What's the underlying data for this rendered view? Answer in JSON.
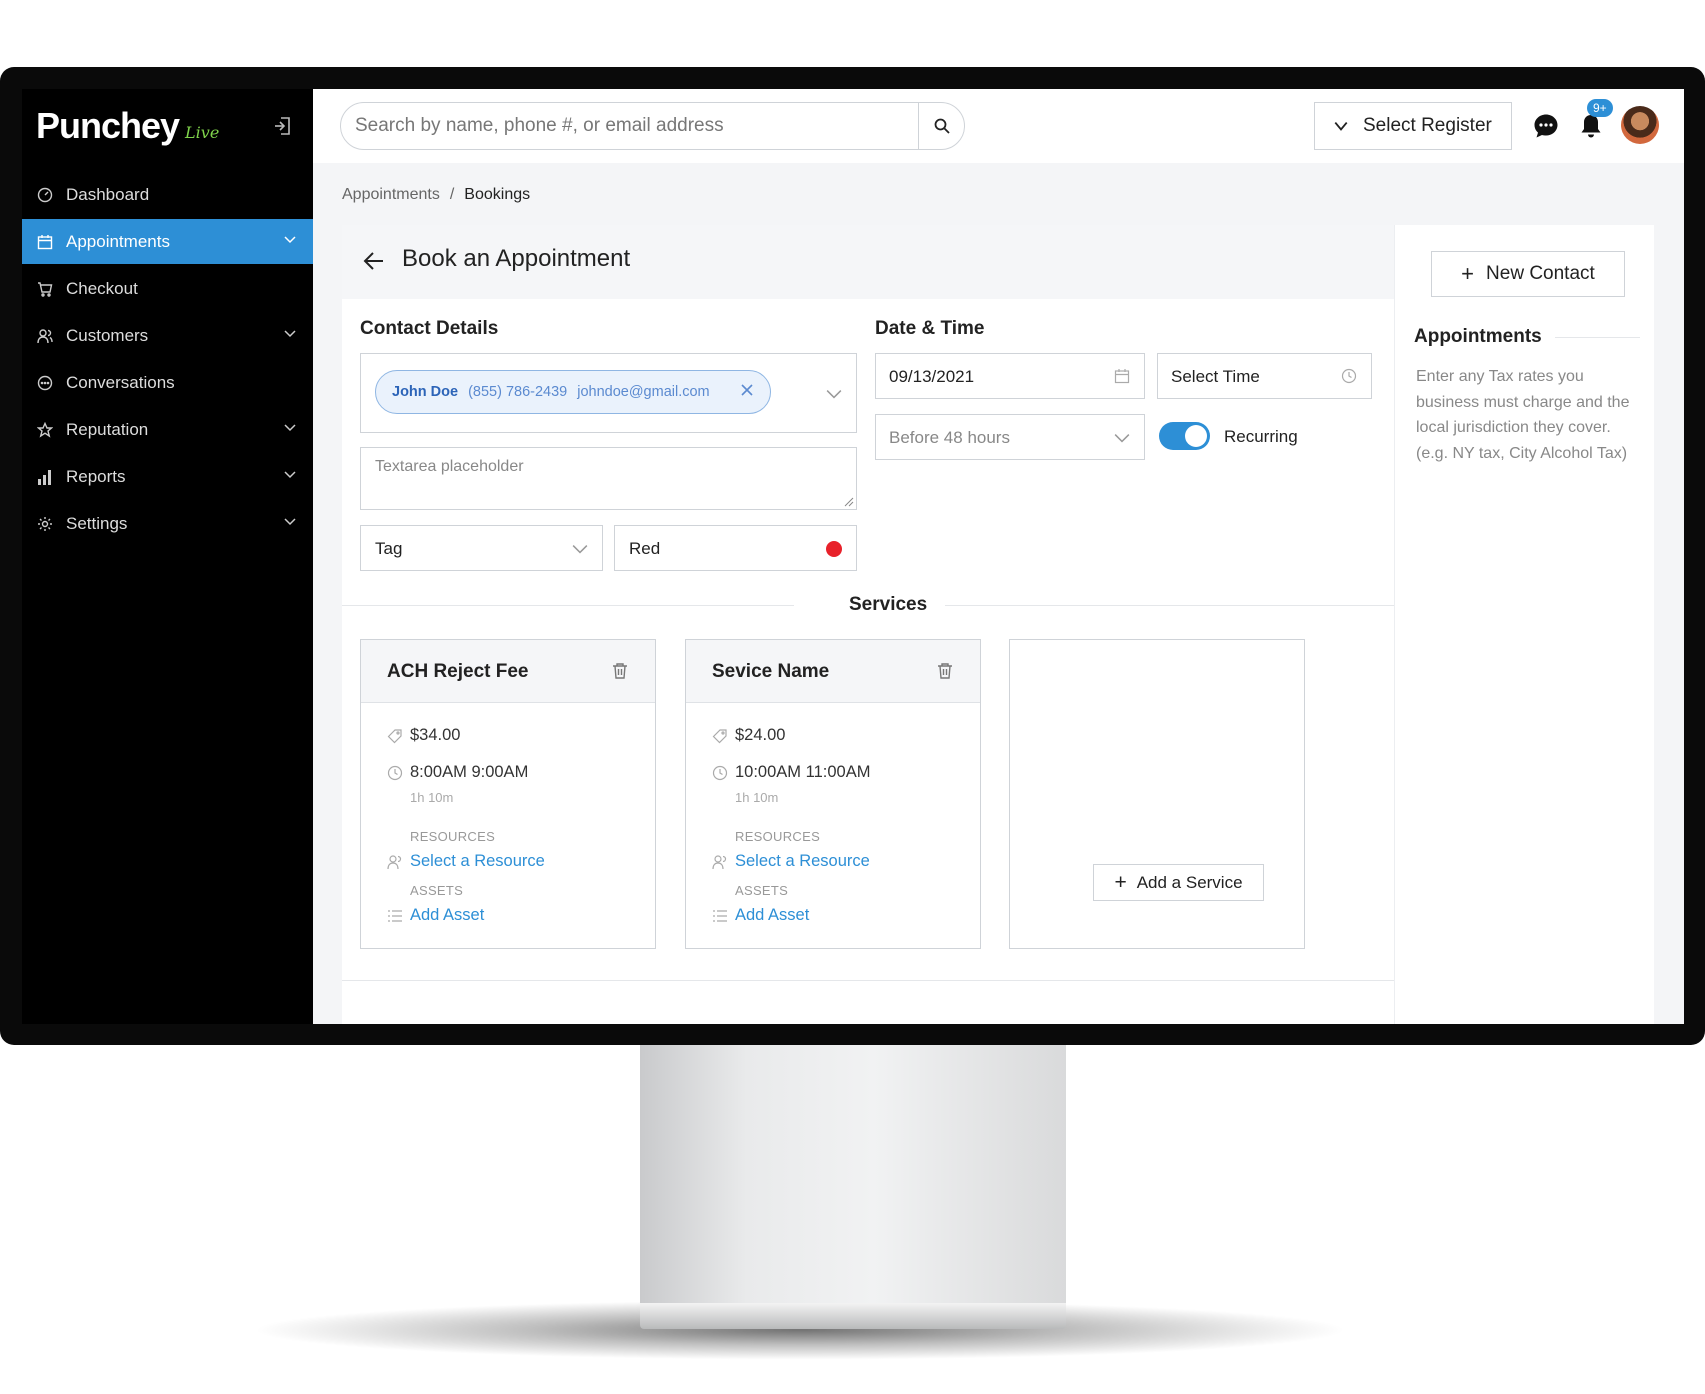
{
  "brand": {
    "name": "Punchey",
    "tag": "Live"
  },
  "sidebar": {
    "items": [
      {
        "label": "Dashboard",
        "icon": "dashboard-icon"
      },
      {
        "label": "Appointments",
        "icon": "calendar-icon",
        "active": true,
        "expandable": true
      },
      {
        "label": "Checkout",
        "icon": "cart-icon"
      },
      {
        "label": "Customers",
        "icon": "customers-icon",
        "expandable": true
      },
      {
        "label": "Conversations",
        "icon": "chat-icon"
      },
      {
        "label": "Reputation",
        "icon": "star-icon",
        "expandable": true
      },
      {
        "label": "Reports",
        "icon": "bar-chart-icon",
        "expandable": true
      },
      {
        "label": "Settings",
        "icon": "gear-icon",
        "expandable": true
      }
    ]
  },
  "topbar": {
    "search_placeholder": "Search by name, phone #, or email address",
    "register_label": "Select Register",
    "notification_count": "9+"
  },
  "breadcrumb": {
    "parent": "Appointments",
    "separator": "/",
    "current": "Bookings"
  },
  "page": {
    "title": "Book an Appointment"
  },
  "contact": {
    "section_title": "Contact Details",
    "name": "John Doe",
    "phone": "(855) 786-2439",
    "email": "johndoe@gmail.com",
    "textarea_placeholder": "Textarea placeholder",
    "tag_placeholder": "Tag",
    "color_value": "Red",
    "color_hex": "#e8212a"
  },
  "datetime": {
    "section_title": "Date & Time",
    "date": "09/13/2021",
    "time_placeholder": "Select Time",
    "reminder": "Before 48 hours",
    "recurring_label": "Recurring",
    "recurring_on": true
  },
  "services": {
    "section_title": "Services",
    "add_label": "Add a Service",
    "resources_caption": "RESOURCES",
    "assets_caption": "ASSETS",
    "items": [
      {
        "name": "ACH Reject Fee",
        "price": "$34.00",
        "time": "8:00AM 9:00AM",
        "duration": "1h 10m",
        "resource_link": "Select a Resource",
        "asset_link": "Add Asset"
      },
      {
        "name": "Sevice Name",
        "price": "$24.00",
        "time": "10:00AM 11:00AM",
        "duration": "1h 10m",
        "resource_link": "Select a Resource",
        "asset_link": "Add Asset"
      }
    ]
  },
  "right_panel": {
    "new_contact_label": "New Contact",
    "title": "Appointments",
    "description": "Enter any Tax rates you business must charge and the local jurisdiction they cover. (e.g. NY tax, City Alcohol Tax)"
  },
  "colors": {
    "accent": "#2d8fd6",
    "sidebar_bg": "#000000"
  }
}
